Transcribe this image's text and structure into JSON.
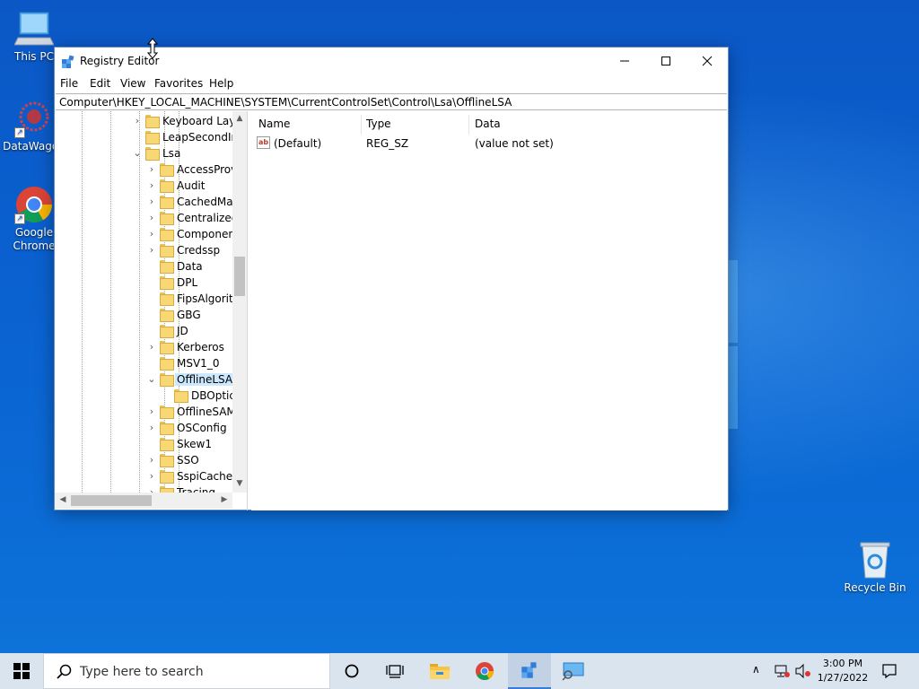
{
  "desktop": {
    "icons": [
      {
        "label": "This PC"
      },
      {
        "label": "DataWagon"
      },
      {
        "label": "Google Chrome"
      },
      {
        "label": "Recycle Bin"
      }
    ]
  },
  "window": {
    "title": "Registry Editor",
    "menu": [
      "File",
      "Edit",
      "View",
      "Favorites",
      "Help"
    ],
    "address": "Computer\\HKEY_LOCAL_MACHINE\\SYSTEM\\CurrentControlSet\\Control\\Lsa\\OfflineLSA",
    "tree": [
      {
        "label": "Keyboard Layo",
        "expander": "collapsed",
        "level": 0
      },
      {
        "label": "LeapSecondIn",
        "expander": "none",
        "level": 0
      },
      {
        "label": "Lsa",
        "expander": "expanded",
        "level": 0
      },
      {
        "label": "AccessProv",
        "expander": "collapsed",
        "level": 1
      },
      {
        "label": "Audit",
        "expander": "collapsed",
        "level": 1
      },
      {
        "label": "CachedMac",
        "expander": "collapsed",
        "level": 1
      },
      {
        "label": "Centralized",
        "expander": "collapsed",
        "level": 1
      },
      {
        "label": "Componen",
        "expander": "collapsed",
        "level": 1
      },
      {
        "label": "Credssp",
        "expander": "collapsed",
        "level": 1
      },
      {
        "label": "Data",
        "expander": "none",
        "level": 1
      },
      {
        "label": "DPL",
        "expander": "none",
        "level": 1
      },
      {
        "label": "FipsAlgoritl",
        "expander": "none",
        "level": 1
      },
      {
        "label": "GBG",
        "expander": "none",
        "level": 1
      },
      {
        "label": "JD",
        "expander": "none",
        "level": 1
      },
      {
        "label": "Kerberos",
        "expander": "collapsed",
        "level": 1
      },
      {
        "label": "MSV1_0",
        "expander": "none",
        "level": 1
      },
      {
        "label": "OfflineLSA",
        "expander": "expanded",
        "level": 1,
        "selected": true
      },
      {
        "label": "DBOptic",
        "expander": "none",
        "level": 2
      },
      {
        "label": "OfflineSAM",
        "expander": "collapsed",
        "level": 1
      },
      {
        "label": "OSConfig",
        "expander": "collapsed",
        "level": 1
      },
      {
        "label": "Skew1",
        "expander": "none",
        "level": 1
      },
      {
        "label": "SSO",
        "expander": "collapsed",
        "level": 1
      },
      {
        "label": "SspiCache",
        "expander": "collapsed",
        "level": 1
      },
      {
        "label": "Tracing",
        "expander": "collapsed",
        "level": 1
      }
    ],
    "list": {
      "columns": [
        "Name",
        "Type",
        "Data"
      ],
      "rows": [
        {
          "name": "(Default)",
          "type": "REG_SZ",
          "data": "(value not set)",
          "icon": "string-value-icon"
        }
      ]
    }
  },
  "taskbar": {
    "search_placeholder": "Type here to search",
    "time": "3:00 PM",
    "date": "1/27/2022"
  },
  "colors": {
    "selection": "#cce8ff",
    "desktop": "#0a5fc8",
    "taskbar": "#dae4ef"
  }
}
